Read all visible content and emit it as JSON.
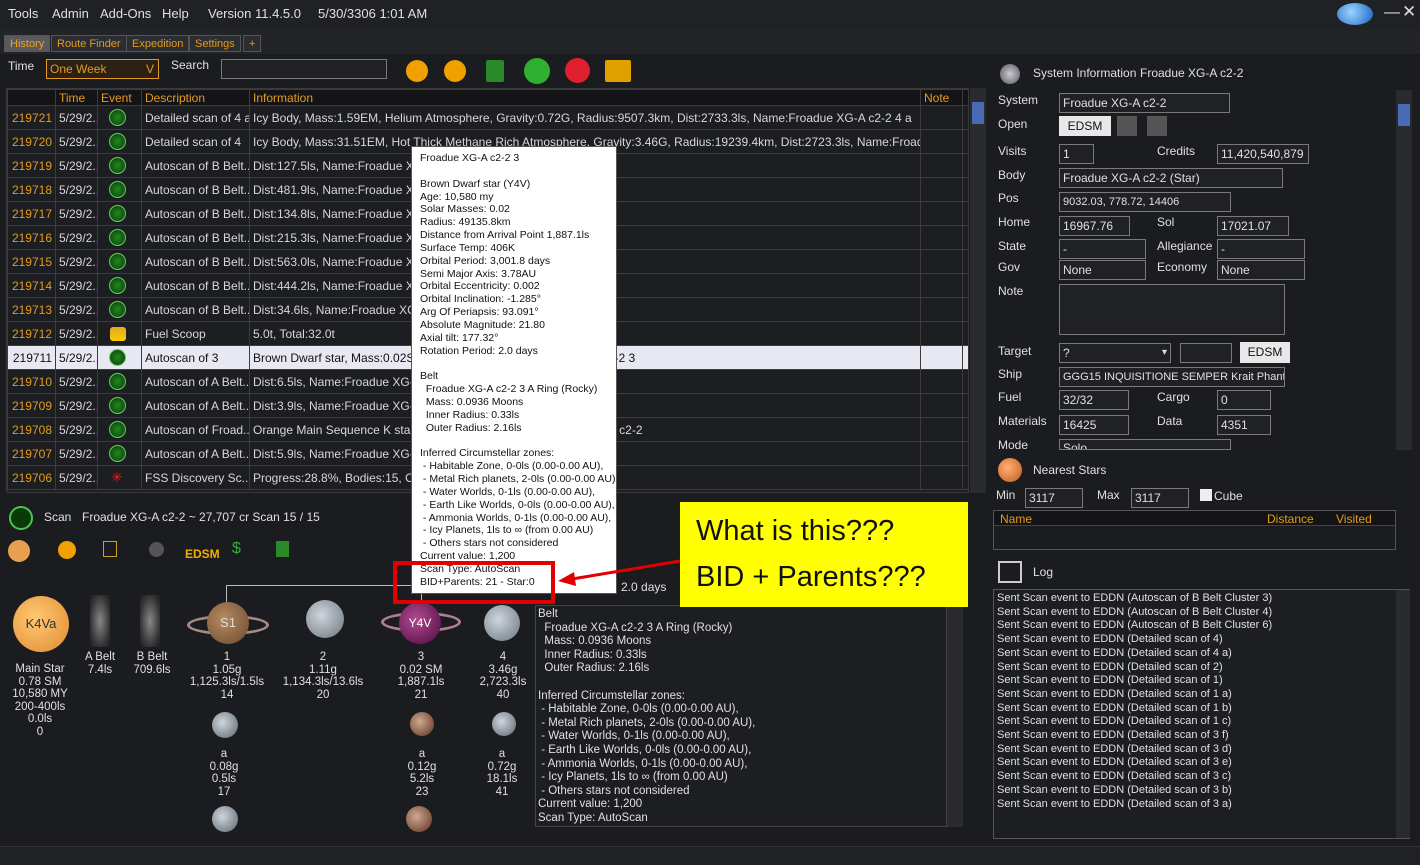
{
  "menu": {
    "items": [
      "Tools",
      "Admin",
      "Add-Ons",
      "Help"
    ],
    "version": "Version 11.4.5.0",
    "date": "5/30/3306 1:01 AM"
  },
  "tabs": [
    "History",
    "Route Finder",
    "Expedition",
    "Settings",
    "+"
  ],
  "filter": {
    "time_label": "Time",
    "time_value": "One Week",
    "search_label": "Search",
    "search_value": ""
  },
  "grid": {
    "headers": [
      "",
      "Time",
      "Event",
      "Description",
      "Information",
      "Note"
    ],
    "rows": [
      {
        "id": "219721",
        "time": "5/29/2...",
        "icon": "globe",
        "desc": "Detailed scan of 4 a",
        "info": "Icy Body, Mass:1.59EM, Helium Atmosphere, Gravity:0.72G, Radius:9507.3km, Dist:2733.3ls, Name:Froadue XG-A c2-2 4 a"
      },
      {
        "id": "219720",
        "time": "5/29/2...",
        "icon": "globe",
        "desc": "Detailed scan of 4",
        "info": "Icy Body, Mass:31.51EM, Hot Thick Methane Rich Atmosphere, Gravity:3.46G, Radius:19239.4km, Dist:2723.3ls, Name:Froadue XG-..."
      },
      {
        "id": "219719",
        "time": "5/29/2...",
        "icon": "globe",
        "desc": "Autoscan of B Belt...",
        "info": "Dist:127.5ls, Name:Froadue XG"
      },
      {
        "id": "219718",
        "time": "5/29/2...",
        "icon": "globe",
        "desc": "Autoscan of B Belt...",
        "info": "Dist:481.9ls, Name:Froadue XG"
      },
      {
        "id": "219717",
        "time": "5/29/2...",
        "icon": "globe",
        "desc": "Autoscan of B Belt...",
        "info": "Dist:134.8ls, Name:Froadue XG"
      },
      {
        "id": "219716",
        "time": "5/29/2...",
        "icon": "globe",
        "desc": "Autoscan of B Belt...",
        "info": "Dist:215.3ls, Name:Froadue XG"
      },
      {
        "id": "219715",
        "time": "5/29/2...",
        "icon": "globe",
        "desc": "Autoscan of B Belt...",
        "info": "Dist:563.0ls, Name:Froadue XG"
      },
      {
        "id": "219714",
        "time": "5/29/2...",
        "icon": "globe",
        "desc": "Autoscan of B Belt...",
        "info": "Dist:444.2ls, Name:Froadue XG"
      },
      {
        "id": "219713",
        "time": "5/29/2...",
        "icon": "globe",
        "desc": "Autoscan of B Belt...",
        "info": "Dist:34.6ls, Name:Froadue XG"
      },
      {
        "id": "219712",
        "time": "5/29/2...",
        "icon": "scoop",
        "desc": "Fuel Scoop",
        "info": "5.0t, Total:32.0t"
      },
      {
        "id": "219711",
        "time": "5/29/2...",
        "icon": "globe",
        "desc": "Autoscan of 3",
        "info": "Brown Dwarf star, Mass:0.02SM                              t:1887.1ls, Name:Froadue XG-A c2-2 3",
        "selected": true
      },
      {
        "id": "219710",
        "time": "5/29/2...",
        "icon": "globe",
        "desc": "Autoscan of A Belt...",
        "info": "Dist:6.5ls, Name:Froadue XG-A"
      },
      {
        "id": "219709",
        "time": "5/29/2...",
        "icon": "globe",
        "desc": "Autoscan of A Belt...",
        "info": "Dist:3.9ls, Name:Froadue XG-A"
      },
      {
        "id": "219708",
        "time": "5/29/2...",
        "icon": "globe",
        "desc": "Autoscan of Froad...",
        "info": "Orange Main Sequence K star                                    9SR, Dist:0.0ls, Name:Froadue XG-A c2-2"
      },
      {
        "id": "219707",
        "time": "5/29/2...",
        "icon": "globe",
        "desc": "Autoscan of A Belt...",
        "info": "Dist:5.9ls, Name:Froadue XG-A"
      },
      {
        "id": "219706",
        "time": "5/29/2...",
        "icon": "fss",
        "desc": "FSS Discovery Sc...",
        "info": "Progress:28.8%, Bodies:15, Ot"
      }
    ]
  },
  "tooltip": "Froadue XG-A c2-2 3\n\nBrown Dwarf star (Y4V)\nAge: 10,580 my\nSolar Masses: 0.02\nRadius: 49135.8km\nDistance from Arrival Point 1,887.1ls\nSurface Temp: 406K\nOrbital Period: 3,001.8 days\nSemi Major Axis: 3.78AU\nOrbital Eccentricity: 0.002\nOrbital Inclination: -1.285°\nArg Of Periapsis: 93.091°\nAbsolute Magnitude: 21.80\nAxial tilt: 177.32°\nRotation Period: 2.0 days\n\nBelt\n  Froadue XG-A c2-2 3 A Ring (Rocky)\n  Mass: 0.0936 Moons\n  Inner Radius: 0.33ls\n  Outer Radius: 2.16ls\n\nInferred Circumstellar zones:\n - Habitable Zone, 0-0ls (0.00-0.00 AU),\n - Metal Rich planets, 2-0ls (0.00-0.00 AU),\n - Water Worlds, 0-1ls (0.00-0.00 AU),\n - Earth Like Worlds, 0-0ls (0.00-0.00 AU),\n - Ammonia Worlds, 0-1ls (0.00-0.00 AU),\n - Icy Planets, 1ls to ∞ (from 0.00 AU)\n - Others stars not considered\nCurrent value: 1,200\nScan Type: AutoScan\nBID+Parents: 21 - Star:0",
  "scan": {
    "title": "Scan",
    "system": "Froadue XG-A c2-2 ~ 27,707 cr Scan 15 / 15",
    "edsm": "EDSM",
    "rotation": "2.0 days"
  },
  "bodies": [
    {
      "label": "K4Va",
      "text": "Main Star\n0.78 SM\n10,580 MY\n200-400ls\n0.0ls\n0"
    },
    {
      "label": "",
      "text": "A Belt\n7.4ls"
    },
    {
      "label": "",
      "text": "B Belt\n709.6ls"
    },
    {
      "label": "S1",
      "text": "1\n1.05g\n1,125.3ls/1.5ls\n14"
    },
    {
      "label": "",
      "text": "2\n1.11g\n1,134.3ls/13.6ls\n20"
    },
    {
      "label": "Y4V",
      "text": "3\n0.02 SM\n1,887.1ls\n21"
    },
    {
      "label": "",
      "text": "4\n3.46g\n2,723.3ls\n40"
    },
    {
      "label": "",
      "text": "a\n0.08g\n0.5ls\n17"
    },
    {
      "label": "",
      "text": "a\n0.12g\n5.2ls\n23"
    },
    {
      "label": "",
      "text": "a\n0.72g\n18.1ls\n41"
    }
  ],
  "scandesc": "Belt\n  Froadue XG-A c2-2 3 A Ring (Rocky)\n  Mass: 0.0936 Moons\n  Inner Radius: 0.33ls\n  Outer Radius: 2.16ls\n\nInferred Circumstellar zones:\n - Habitable Zone, 0-0ls (0.00-0.00 AU),\n - Metal Rich planets, 2-0ls (0.00-0.00 AU),\n - Water Worlds, 0-1ls (0.00-0.00 AU),\n - Earth Like Worlds, 0-0ls (0.00-0.00 AU),\n - Ammonia Worlds, 0-1ls (0.00-0.00 AU),\n - Icy Planets, 1ls to ∞ (from 0.00 AU)\n - Others stars not considered\nCurrent value: 1,200\nScan Type: AutoScan",
  "annotation": {
    "line1": "What is this???",
    "line2": "BID + Parents???"
  },
  "sysinfo": {
    "title": "System Information",
    "system_name": "Froadue XG-A c2-2",
    "labels": {
      "system": "System",
      "open": "Open",
      "visits": "Visits",
      "credits": "Credits",
      "body": "Body",
      "pos": "Pos",
      "home": "Home",
      "sol": "Sol",
      "state": "State",
      "allegiance": "Allegiance",
      "gov": "Gov",
      "economy": "Economy",
      "note": "Note",
      "target": "Target",
      "ship": "Ship",
      "fuel": "Fuel",
      "cargo": "Cargo",
      "materials": "Materials",
      "data": "Data",
      "mode": "Mode"
    },
    "values": {
      "system": "Froadue XG-A c2-2",
      "edsm": "EDSM",
      "visits": "1",
      "credits": "11,420,540,879",
      "body": "Froadue XG-A c2-2 (Star)",
      "pos": "9032.03, 778.72, 14406",
      "home": "16967.76",
      "sol": "17021.07",
      "state": "-",
      "allegiance": "-",
      "gov": "None",
      "economy": "None",
      "target": "?",
      "target_edsm": "EDSM",
      "ship": "GGG15 INQUISITIONE SEMPER Krait Phant",
      "fuel": "32/32",
      "cargo": "0",
      "materials": "16425",
      "data": "4351",
      "mode": "Solo"
    }
  },
  "nearest": {
    "title": "Nearest Stars",
    "min_label": "Min",
    "min": "3117",
    "max_label": "Max",
    "max": "3117",
    "cube": "Cube",
    "cols": [
      "Name",
      "Distance",
      "Visited"
    ]
  },
  "log": {
    "title": "Log",
    "lines": [
      "Sent Scan event to EDDN (Autoscan of B Belt Cluster 3)",
      "Sent Scan event to EDDN (Autoscan of B Belt Cluster 4)",
      "Sent Scan event to EDDN (Autoscan of B Belt Cluster 6)",
      "Sent Scan event to EDDN (Detailed scan of 4)",
      "Sent Scan event to EDDN (Detailed scan of 4 a)",
      "Sent Scan event to EDDN (Detailed scan of 2)",
      "Sent Scan event to EDDN (Detailed scan of 1)",
      "Sent Scan event to EDDN (Detailed scan of 1 a)",
      "Sent Scan event to EDDN (Detailed scan of 1 b)",
      "Sent Scan event to EDDN (Detailed scan of 1 c)",
      "Sent Scan event to EDDN (Detailed scan of 3 f)",
      "Sent Scan event to EDDN (Detailed scan of 3 d)",
      "Sent Scan event to EDDN (Detailed scan of 3 e)",
      "Sent Scan event to EDDN (Detailed scan of 3 c)",
      "Sent Scan event to EDDN (Detailed scan of 3 b)",
      "Sent Scan event to EDDN (Detailed scan of 3 a)"
    ]
  }
}
